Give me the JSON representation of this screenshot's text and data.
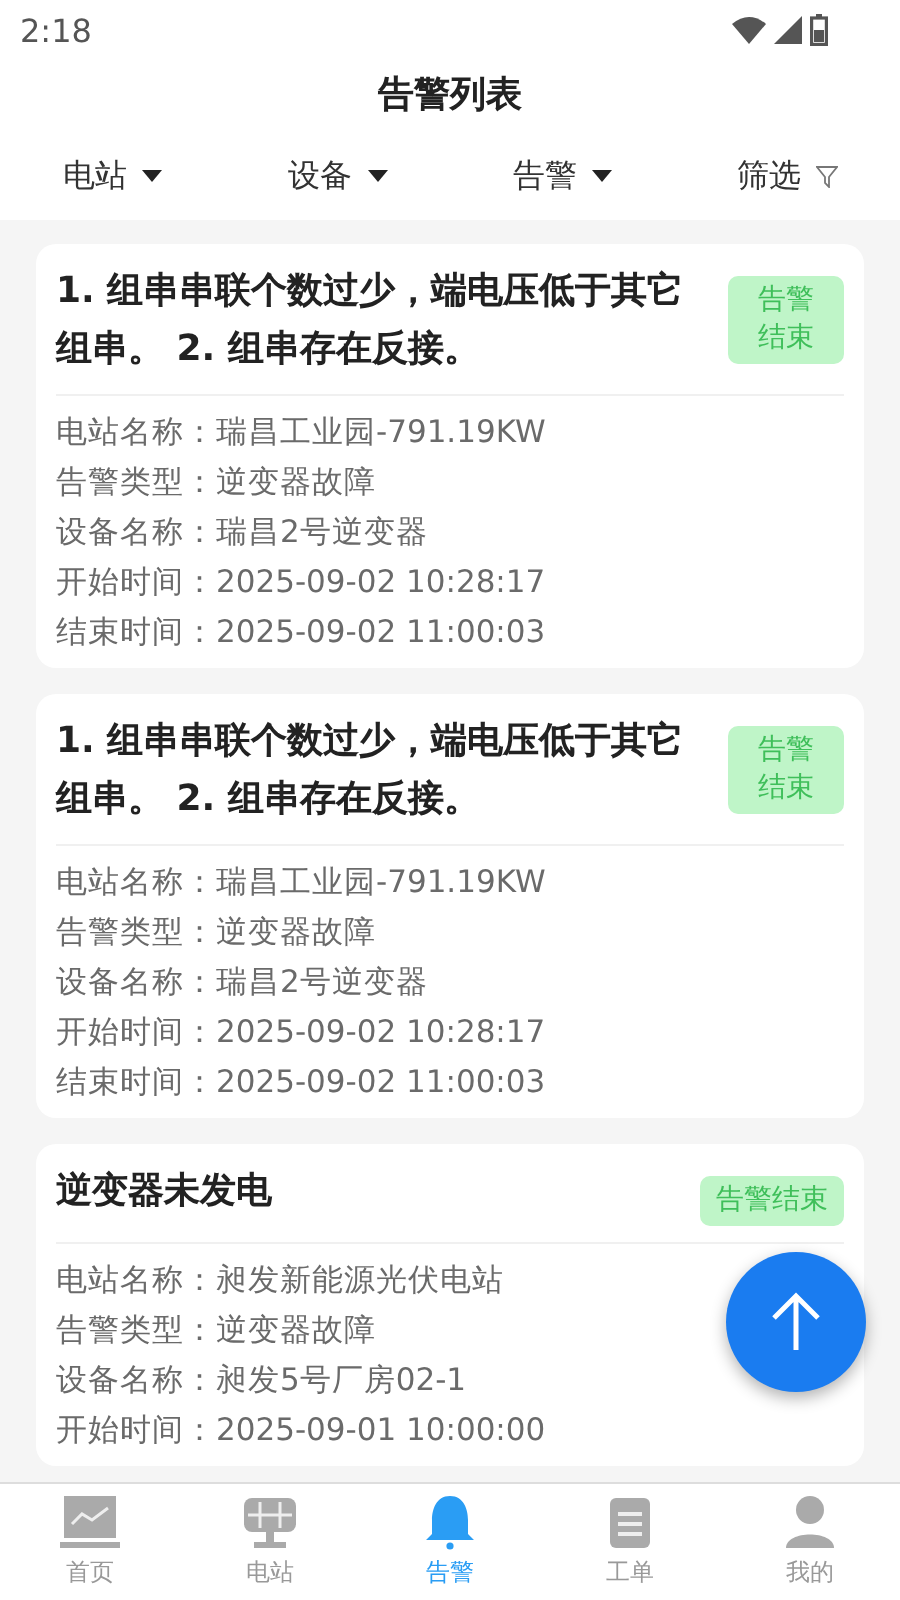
{
  "status_bar": {
    "time": "2:18"
  },
  "header": {
    "title": "告警列表"
  },
  "filters": [
    {
      "label": "电站",
      "kind": "dropdown"
    },
    {
      "label": "设备",
      "kind": "dropdown"
    },
    {
      "label": "告警",
      "kind": "dropdown"
    },
    {
      "label": "筛选",
      "kind": "filter"
    }
  ],
  "alarms": [
    {
      "title": "1. 组串串联个数过少，端电压低于其它组串。 2. 组串存在反接。",
      "badge": "告警结束",
      "fields": [
        {
          "label": "电站名称：",
          "value": "瑞昌工业园-791.19KW"
        },
        {
          "label": "告警类型：",
          "value": "逆变器故障"
        },
        {
          "label": "设备名称：",
          "value": "瑞昌2号逆变器"
        },
        {
          "label": "开始时间：",
          "value": "2025-09-02 10:28:17"
        },
        {
          "label": "结束时间：",
          "value": "2025-09-02 11:00:03"
        }
      ]
    },
    {
      "title": "1. 组串串联个数过少，端电压低于其它组串。 2. 组串存在反接。",
      "badge": "告警结束",
      "fields": [
        {
          "label": "电站名称：",
          "value": "瑞昌工业园-791.19KW"
        },
        {
          "label": "告警类型：",
          "value": "逆变器故障"
        },
        {
          "label": "设备名称：",
          "value": "瑞昌2号逆变器"
        },
        {
          "label": "开始时间：",
          "value": "2025-09-02 10:28:17"
        },
        {
          "label": "结束时间：",
          "value": "2025-09-02 11:00:03"
        }
      ]
    },
    {
      "title": "逆变器未发电",
      "badge": "告警结束",
      "fields": [
        {
          "label": "电站名称：",
          "value": "昶发新能源光伏电站"
        },
        {
          "label": "告警类型：",
          "value": "逆变器故障"
        },
        {
          "label": "设备名称：",
          "value": "昶发5号厂房02-1"
        },
        {
          "label": "开始时间：",
          "value": "2025-09-01 10:00:00"
        }
      ]
    }
  ],
  "tabs": [
    {
      "label": "首页",
      "selected": false
    },
    {
      "label": "电站",
      "selected": false
    },
    {
      "label": "告警",
      "selected": true
    },
    {
      "label": "工单",
      "selected": false
    },
    {
      "label": "我的",
      "selected": false
    }
  ]
}
